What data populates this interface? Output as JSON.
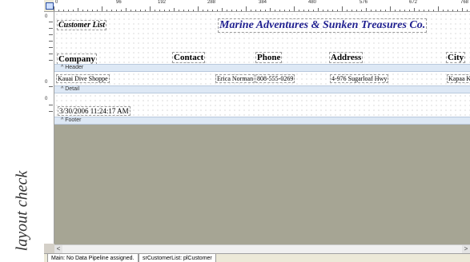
{
  "side_note": "layout check",
  "ruler": {
    "h_labels": [
      "0",
      "96",
      "192",
      "288",
      "384",
      "480",
      "576",
      "672",
      "768"
    ],
    "v_labels": [
      "0",
      "0",
      "0"
    ]
  },
  "report": {
    "title_left": "Customer List",
    "title_main": "Marine Adventures & Sunken Treasures Co.",
    "columns": [
      "Company",
      "Contact",
      "Phone",
      "Address",
      "City"
    ],
    "detail": [
      "Kauai Dive Shoppe",
      "Erica Norman",
      "808-555-0269",
      "4-976 Sugarloaf Hwy",
      "Kapaa K"
    ],
    "footer_timestamp": "3/30/2006 11:24:17 AM"
  },
  "bands": {
    "header_label": "^ Header",
    "detail_label": "^ Detail",
    "footer_label": "^ Footer"
  },
  "scroll": {
    "left_arrow": "<",
    "right_arrow": ">"
  },
  "status": {
    "main_tab": "Main: No Data Pipeline assigned.",
    "second_tab": "srCustomerList: plCustomer"
  },
  "colors": {
    "title_color": "#1f1f8f",
    "workspace_gray": "#a6a594",
    "band_bar": "#dde8f5"
  },
  "icons": [
    "report-layout-icon"
  ]
}
